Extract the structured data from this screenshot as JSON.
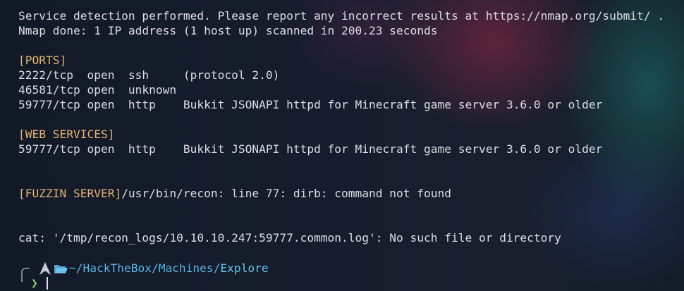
{
  "output": {
    "service_detection": "Service detection performed. Please report any incorrect results at https://nmap.org/submit/ .",
    "nmap_done": "Nmap done: 1 IP address (1 host up) scanned in 200.23 seconds",
    "ports_header": "[PORTS]",
    "ports": [
      "2222/tcp  open  ssh     (protocol 2.0)",
      "46581/tcp open  unknown",
      "59777/tcp open  http    Bukkit JSONAPI httpd for Minecraft game server 3.6.0 or older"
    ],
    "web_services_header": "[WEB SERVICES]",
    "web_services": [
      "59777/tcp open  http    Bukkit JSONAPI httpd for Minecraft game server 3.6.0 or older"
    ],
    "fuzzin_header": "[FUZZIN SERVER]",
    "fuzzin_error": "/usr/bin/recon: line 77: dirb: command not found",
    "cat_error": "cat: '/tmp/recon_logs/10.10.10.247:59777.common.log': No such file or directory"
  },
  "prompt": {
    "path_home": "~/HackTheBox/Machines/",
    "path_current": "Explore",
    "chevron": "❯",
    "os_icon": "arch-linux-icon",
    "folder_icon": "open-folder-icon"
  },
  "colors": {
    "text": "#dadde6",
    "header": "#e4b272",
    "path": "#56b6e6",
    "chevron": "#8ed16f"
  }
}
